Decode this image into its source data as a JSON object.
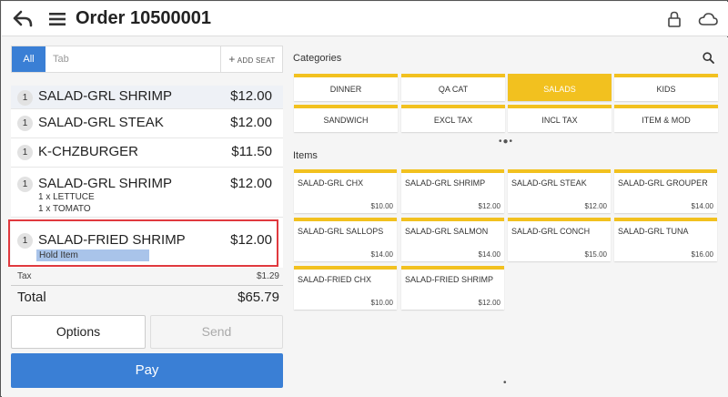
{
  "header": {
    "title": "Order 10500001",
    "icons": [
      "back-arrow-icon",
      "hamburger-menu-icon",
      "lock-icon",
      "cloud-icon"
    ]
  },
  "tabs": {
    "all_label": "All",
    "tab_placeholder": "Tab",
    "add_seat_label": "ADD SEAT"
  },
  "order_items": [
    {
      "qty": "1",
      "name": "SALAD-GRL SHRIMP",
      "price": "$12.00"
    },
    {
      "qty": "1",
      "name": "SALAD-GRL STEAK",
      "price": "$12.00"
    },
    {
      "qty": "1",
      "name": "K-CHZBURGER",
      "price": "$11.50"
    },
    {
      "qty": "1",
      "name": "SALAD-GRL SHRIMP",
      "price": "$12.00",
      "modifiers": [
        "1 x  LETTUCE",
        "1 x  TOMATO"
      ]
    },
    {
      "qty": "1",
      "name": "SALAD-FRIED SHRIMP",
      "price": "$12.00",
      "status": "Hold Item"
    }
  ],
  "totals": {
    "tax_label": "Tax",
    "tax_value": "$1.29",
    "total_label": "Total",
    "total_value": "$65.79"
  },
  "actions": {
    "options_label": "Options",
    "send_label": "Send",
    "pay_label": "Pay"
  },
  "categories": {
    "label": "Categories",
    "buttons": [
      "DINNER",
      "QA CAT",
      "SALADS",
      "KIDS",
      "SANDWICH",
      "EXCL TAX",
      "INCL TAX",
      "ITEM & MOD"
    ],
    "selected": "SALADS"
  },
  "items": {
    "label": "Items",
    "tiles": [
      {
        "name": "SALAD-GRL CHX",
        "price": "$10.00"
      },
      {
        "name": "SALAD-GRL SHRIMP",
        "price": "$12.00"
      },
      {
        "name": "SALAD-GRL STEAK",
        "price": "$12.00"
      },
      {
        "name": "SALAD-GRL GROUPER",
        "price": "$14.00"
      },
      {
        "name": "SALAD-GRL SALLOPS",
        "price": "$14.00"
      },
      {
        "name": "SALAD-GRL SALMON",
        "price": "$14.00"
      },
      {
        "name": "SALAD-GRL CONCH",
        "price": "$15.00"
      },
      {
        "name": "SALAD-GRL TUNA",
        "price": "$16.00"
      },
      {
        "name": "SALAD-FRIED CHX",
        "price": "$10.00"
      },
      {
        "name": "SALAD-FRIED SHRIMP",
        "price": "$12.00"
      }
    ]
  },
  "colors": {
    "accent_blue": "#3a7fd5",
    "category_yellow": "#f2c11f",
    "highlight_red": "#e0393e",
    "hold_chip_blue": "#a9c4ea"
  }
}
